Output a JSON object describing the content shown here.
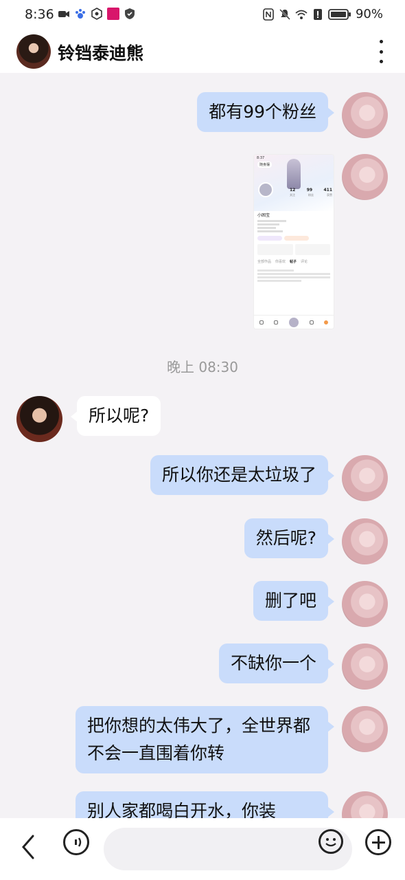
{
  "status_bar": {
    "time": "8:36",
    "battery": "90%"
  },
  "header": {
    "contact_name": "铃铛泰迪熊"
  },
  "timestamp": "晚上 08:30",
  "messages": {
    "m1": "都有99个粉丝",
    "m2": "所以呢?",
    "m3": "所以你还是太垃圾了",
    "m4": "然后呢?",
    "m5": "删了吧",
    "m6": "不缺你一个",
    "m7": "把你想的太伟大了，全世界都不会一直围着你转",
    "m8": "别人家都喝白开水，你装"
  },
  "shared_image": {
    "status": "8:37",
    "tag": "随身摆",
    "nickname": "小困宝",
    "stats": {
      "following": "12",
      "followers": "99",
      "likes": "411"
    },
    "stat_labels": {
      "following": "关注",
      "followers": "粉丝",
      "likes": "获赞"
    },
    "tabs": [
      "全部作品",
      "你喜欢",
      "帖子",
      "评论"
    ]
  },
  "input": {
    "placeholder": ""
  }
}
